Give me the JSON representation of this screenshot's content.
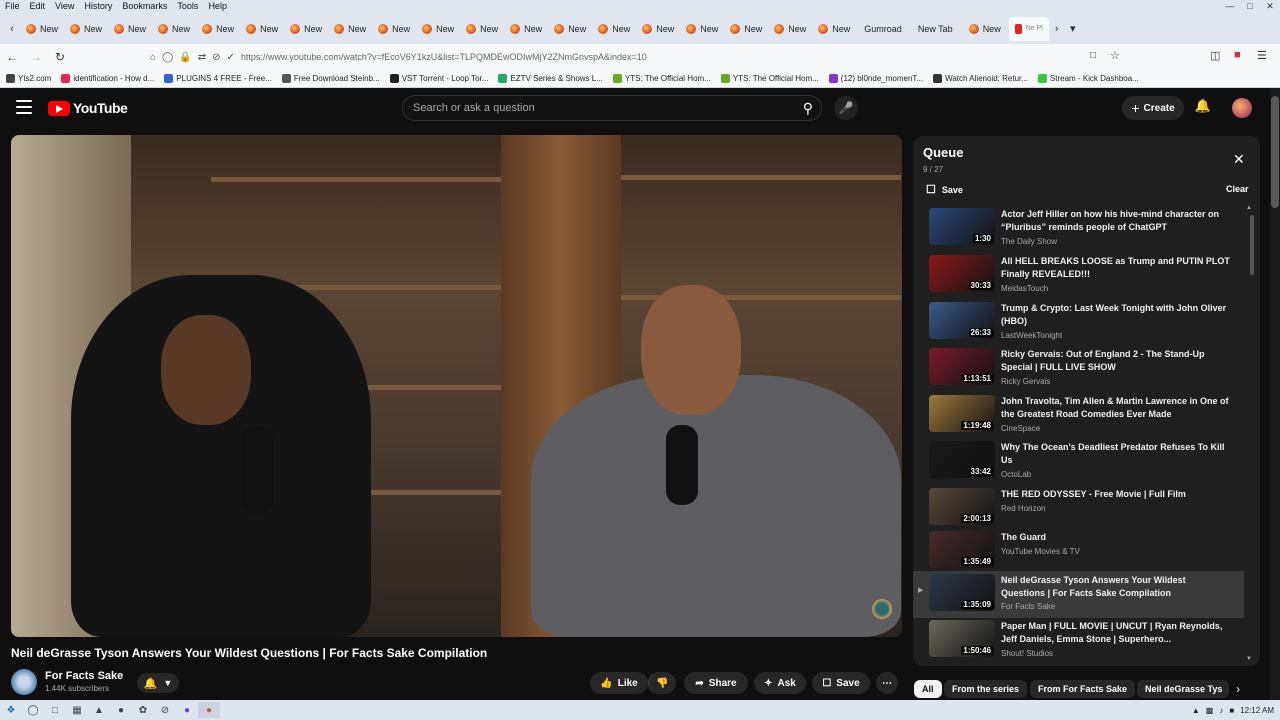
{
  "menu": [
    "File",
    "Edit",
    "View",
    "History",
    "Bookmarks",
    "Tools",
    "Help"
  ],
  "tabs": {
    "items": [
      "New",
      "New",
      "New",
      "New",
      "New",
      "New",
      "New",
      "New",
      "New",
      "New",
      "New",
      "New",
      "New",
      "New",
      "New",
      "New",
      "New",
      "New",
      "New"
    ],
    "plain": [
      "Gumroad",
      "New Tab",
      "New"
    ],
    "active_label": "Ne Pl"
  },
  "nav": {
    "url": "https://www.youtube.com/watch?v=fEcoV6Y1kzU&list=TLPQMDEwODIwMjY2ZNmGnvspA&index=10"
  },
  "bookmarks": [
    "Yts2.com",
    "identification - How d...",
    "PLUGINS 4 FREE - Free...",
    "Free Download Steinb...",
    "VST Torrent - Loop Tor...",
    "EZTV Series & Shows L...",
    "YTS: The Official Hom...",
    "YTS: The Official Hom...",
    "(12) bl0nde_momenT...",
    "Watch Alienoid: Retur...",
    "Stream - Kick Dashboa..."
  ],
  "header": {
    "logo": "YouTube",
    "search_placeholder": "Search or ask a question",
    "create_label": "Create"
  },
  "video": {
    "title": "Neil deGrasse Tyson Answers Your Wildest Questions | For Facts Sake Compilation",
    "channel": "For Facts Sake",
    "subscribers": "1.44K subscribers",
    "actions": {
      "like": "Like",
      "share": "Share",
      "ask": "Ask",
      "save": "Save"
    }
  },
  "queue": {
    "title": "Queue",
    "count": "9 / 27",
    "save_label": "Save",
    "clear_label": "Clear",
    "items": [
      {
        "title": "Actor Jeff Hiller on how his hive-mind character on “Pluribus” reminds people of ChatGPT",
        "channel": "The Daily Show",
        "duration": "1:30",
        "color": "#2c4a7a"
      },
      {
        "title": "All HELL BREAKS LOOSE as Trump and PUTIN PLOT Finally REVEALED!!!",
        "channel": "MeidasTouch",
        "duration": "30:33",
        "color": "#8a1a1a"
      },
      {
        "title": "Trump & Crypto: Last Week Tonight with John Oliver (HBO)",
        "channel": "LastWeekTonight",
        "duration": "26:33",
        "color": "#3a5a8a"
      },
      {
        "title": "Ricky Gervais: Out of England 2 - The Stand-Up Special | FULL LIVE SHOW",
        "channel": "Ricky Gervais",
        "duration": "1:13:51",
        "color": "#7a1a2a"
      },
      {
        "title": "John Travolta, Tim Allen & Martin Lawrence in One of the Greatest Road Comedies Ever Made",
        "channel": "CineSpace",
        "duration": "1:19:48",
        "color": "#a07a3a"
      },
      {
        "title": "Why The Ocean's Deadliest Predator Refuses To Kill Us",
        "channel": "OctoLab",
        "duration": "33:42",
        "color": "#1a1a1a"
      },
      {
        "title": "THE RED ODYSSEY - Free Movie | Full Film",
        "channel": "Red Horizon",
        "duration": "2:00:13",
        "color": "#5a4a3a"
      },
      {
        "title": "The Guard",
        "channel": "YouTube Movies & TV",
        "duration": "1:35:49",
        "color": "#4a2a2a"
      },
      {
        "title": "Neil deGrasse Tyson Answers Your Wildest Questions | For Facts Sake Compilation",
        "channel": "For Facts Sake",
        "duration": "1:35:09",
        "color": "#2a3a4a"
      },
      {
        "title": "Paper Man | FULL MOVIE | UNCUT | Ryan Reynolds, Jeff Daniels, Emma Stone | Superhero...",
        "channel": "Shout! Studios",
        "duration": "1:50:46",
        "color": "#6a6a5a"
      }
    ]
  },
  "chips": [
    "All",
    "From the series",
    "From For Facts Sake",
    "Neil deGrasse Tys"
  ],
  "taskbar": {
    "time": "12:12 AM"
  }
}
